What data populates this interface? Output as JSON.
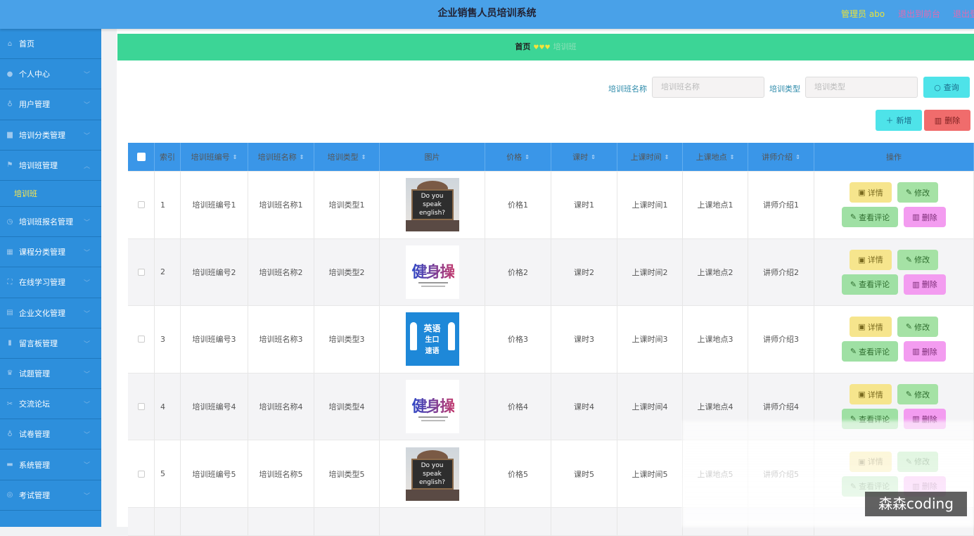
{
  "header": {
    "title": "企业销售人员培训系统",
    "admin": "管理员 abo",
    "link_front": "退出到前台",
    "link_logout": "退出登录"
  },
  "sidebar": {
    "items": [
      {
        "label": "首页",
        "icon": "home-icon",
        "chevron": false
      },
      {
        "label": "个人中心",
        "icon": "user-icon",
        "chevron": true
      },
      {
        "label": "用户管理",
        "icon": "mic-icon",
        "chevron": true
      },
      {
        "label": "培训分类管理",
        "icon": "briefcase-icon",
        "chevron": true
      },
      {
        "label": "培训班管理",
        "icon": "flag-icon",
        "chevron": true,
        "open": true
      },
      {
        "label": "培训班报名管理",
        "icon": "clock-icon",
        "chevron": true
      },
      {
        "label": "课程分类管理",
        "icon": "grid-icon",
        "chevron": true
      },
      {
        "label": "在线学习管理",
        "icon": "frame-icon",
        "chevron": true
      },
      {
        "label": "企业文化管理",
        "icon": "document-icon",
        "chevron": true
      },
      {
        "label": "留言板管理",
        "icon": "bar-chart-icon",
        "chevron": true
      },
      {
        "label": "试题管理",
        "icon": "trophy-icon",
        "chevron": true
      },
      {
        "label": "交流论坛",
        "icon": "ticket-icon",
        "chevron": true
      },
      {
        "label": "试卷管理",
        "icon": "mic-icon",
        "chevron": true
      },
      {
        "label": "系统管理",
        "icon": "monitor-icon",
        "chevron": true
      },
      {
        "label": "考试管理",
        "icon": "globe-icon",
        "chevron": true
      }
    ],
    "subitem": "培训班"
  },
  "breadcrumb": {
    "home": "首页",
    "current": "培训班"
  },
  "search": {
    "label1": "培训班名称",
    "placeholder1": "培训班名称",
    "label2": "培训类型",
    "placeholder2": "培训类型",
    "query": "查询",
    "add": "新增",
    "delete": "删除"
  },
  "table": {
    "headers": [
      "索引",
      "培训班编号",
      "培训班名称",
      "培训类型",
      "图片",
      "价格",
      "课时",
      "上课时间",
      "上课地点",
      "讲师介绍",
      "操作"
    ],
    "rows": [
      {
        "idx": "1",
        "code": "培训班编号1",
        "name": "培训班名称1",
        "type": "培训类型1",
        "img": "speak",
        "price": "价格1",
        "hours": "课时1",
        "time": "上课时间1",
        "place": "上课地点1",
        "teacher": "讲师介绍1"
      },
      {
        "idx": "2",
        "code": "培训班编号2",
        "name": "培训班名称2",
        "type": "培训类型2",
        "img": "jiancao",
        "price": "价格2",
        "hours": "课时2",
        "time": "上课时间2",
        "place": "上课地点2",
        "teacher": "讲师介绍2"
      },
      {
        "idx": "3",
        "code": "培训班编号3",
        "name": "培训班名称3",
        "type": "培训类型3",
        "img": "english",
        "price": "价格3",
        "hours": "课时3",
        "time": "上课时间3",
        "place": "上课地点3",
        "teacher": "讲师介绍3"
      },
      {
        "idx": "4",
        "code": "培训班编号4",
        "name": "培训班名称4",
        "type": "培训类型4",
        "img": "jiancao",
        "price": "价格4",
        "hours": "课时4",
        "time": "上课时间4",
        "place": "上课地点4",
        "teacher": "讲师介绍4"
      },
      {
        "idx": "5",
        "code": "培训班编号5",
        "name": "培训班名称5",
        "type": "培训类型5",
        "img": "speak",
        "price": "价格5",
        "hours": "课时5",
        "time": "上课时间5",
        "place": "上课地点5",
        "teacher": "讲师介绍5"
      }
    ],
    "actions": {
      "detail": "详情",
      "edit": "修改",
      "comments": "查看评论",
      "delete": "删除"
    }
  },
  "image_text": {
    "speak": [
      "Do you",
      "speak",
      "english?"
    ],
    "jiancao": "健身操",
    "english": [
      "英语",
      "生口",
      "速语"
    ]
  },
  "colors": {
    "topbar": "#49a1e8",
    "sidebar": "#2d8fdc",
    "breadcrumb": "#3cd596",
    "table_header": "#3a96e8",
    "detail_btn": "#f6e58d",
    "edit_btn": "#a5e2a5",
    "comments_btn": "#9fe0a4",
    "delete_btn": "#f39cf0",
    "query_btn": "#4ee3e9",
    "add_btn": "#4ee3e9",
    "batch_delete_btn": "#f06c6c"
  },
  "watermark": "森森coding"
}
